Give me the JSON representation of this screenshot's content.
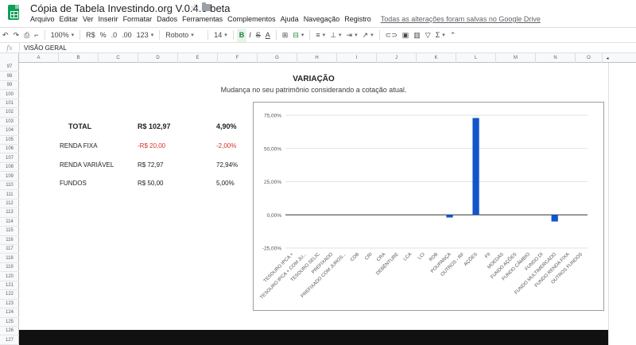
{
  "document": {
    "title": "Cópia de Tabela Investindo.org V.0.4.0 beta",
    "menu": [
      "Arquivo",
      "Editar",
      "Ver",
      "Inserir",
      "Formatar",
      "Dados",
      "Ferramentas",
      "Complementos",
      "Ajuda",
      "Navegação",
      "Registro"
    ],
    "save_status": "Todas as alterações foram salvas no Google Drive"
  },
  "toolbar": {
    "undo_icon": "↶",
    "redo_icon": "↷",
    "print_icon": "⎙",
    "paint_format_icon": "⌐",
    "zoom": "100%",
    "currency": "R$",
    "percent": "%",
    "decimal_decrease": ".0",
    "decimal_increase": ".00",
    "more_formats": "123",
    "font": "Roboto",
    "font_size": "14",
    "bold": "B",
    "italic": "I",
    "strikethrough": "S",
    "text_color": "A",
    "borders_icon": "⊞",
    "merge_icon": "⊟",
    "align_icon": "≡",
    "valign_icon": "⊥",
    "wrap_icon": "⇥",
    "rotate_icon": "↗",
    "link_icon": "⊂⊃",
    "comment_icon": "▣",
    "chart_icon": "▥",
    "filter_icon": "▽",
    "functions_icon": "Σ",
    "more_icon": "⌃"
  },
  "formula_bar": {
    "fx": "fx",
    "value": "VISÃO GERAL"
  },
  "columns": [
    "A",
    "B",
    "C",
    "D",
    "E",
    "F",
    "G",
    "H",
    "I",
    "J",
    "K",
    "L",
    "M",
    "N",
    "O"
  ],
  "rows": [
    "97",
    "98",
    "99",
    "100",
    "101",
    "102",
    "103",
    "104",
    "105",
    "106",
    "107",
    "108",
    "109",
    "110",
    "111",
    "112",
    "113",
    "114",
    "115",
    "116",
    "117",
    "118",
    "119",
    "120",
    "121",
    "122",
    "123",
    "124",
    "125",
    "126",
    "127"
  ],
  "section": {
    "title": "VARIAÇÃO",
    "subtitle": "Mudança no seu patrimônio considerando a cotação atual."
  },
  "summary": [
    {
      "label": "TOTAL",
      "value": "R$ 102,97",
      "percent": "4,90%",
      "negative": false,
      "bold": true
    },
    {
      "label": "RENDA FIXA",
      "value": "-R$ 20,00",
      "percent": "-2,00%",
      "negative": true,
      "bold": false
    },
    {
      "label": "RENDA VARIÁVEL",
      "value": "R$ 72,97",
      "percent": "72,94%",
      "negative": false,
      "bold": false
    },
    {
      "label": "FUNDOS",
      "value": "R$ 50,00",
      "percent": "5,00%",
      "negative": false,
      "bold": false
    }
  ],
  "chart_data": {
    "type": "bar",
    "categories": [
      "TESOURO IPCA +",
      "TESOURO IPCA + COM JU...",
      "TESOURO SELIC",
      "PREFIXADO",
      "PREFIXADO COM JUROS...",
      "CDB",
      "CRI",
      "CRA",
      "DEBÊNTURE",
      "LCA",
      "LCI",
      "RDB",
      "POUPANÇA",
      "OUTROS - RF",
      "AÇÕES",
      "FII",
      "MOEDAS",
      "FUNDO AÇÕES",
      "FUNDO CÂMBIO",
      "FUNDO DI",
      "FUNDO MULTIMERCADO",
      "FUNDO RENDA FIXA",
      "OUTROS FUNDOS"
    ],
    "values": [
      0,
      0,
      0,
      0,
      0,
      0,
      0,
      0,
      0,
      0,
      0,
      0,
      -2,
      0,
      72.94,
      0,
      0,
      0,
      0,
      0,
      -5,
      0,
      0
    ],
    "yticks": [
      "75,00%",
      "50,00%",
      "25,00%",
      "0,00%",
      "-25,00%"
    ],
    "ytick_values": [
      75,
      50,
      25,
      0,
      -25
    ],
    "ylim": [
      -25,
      75
    ],
    "bar_color": "#1155cc",
    "grid": true
  }
}
